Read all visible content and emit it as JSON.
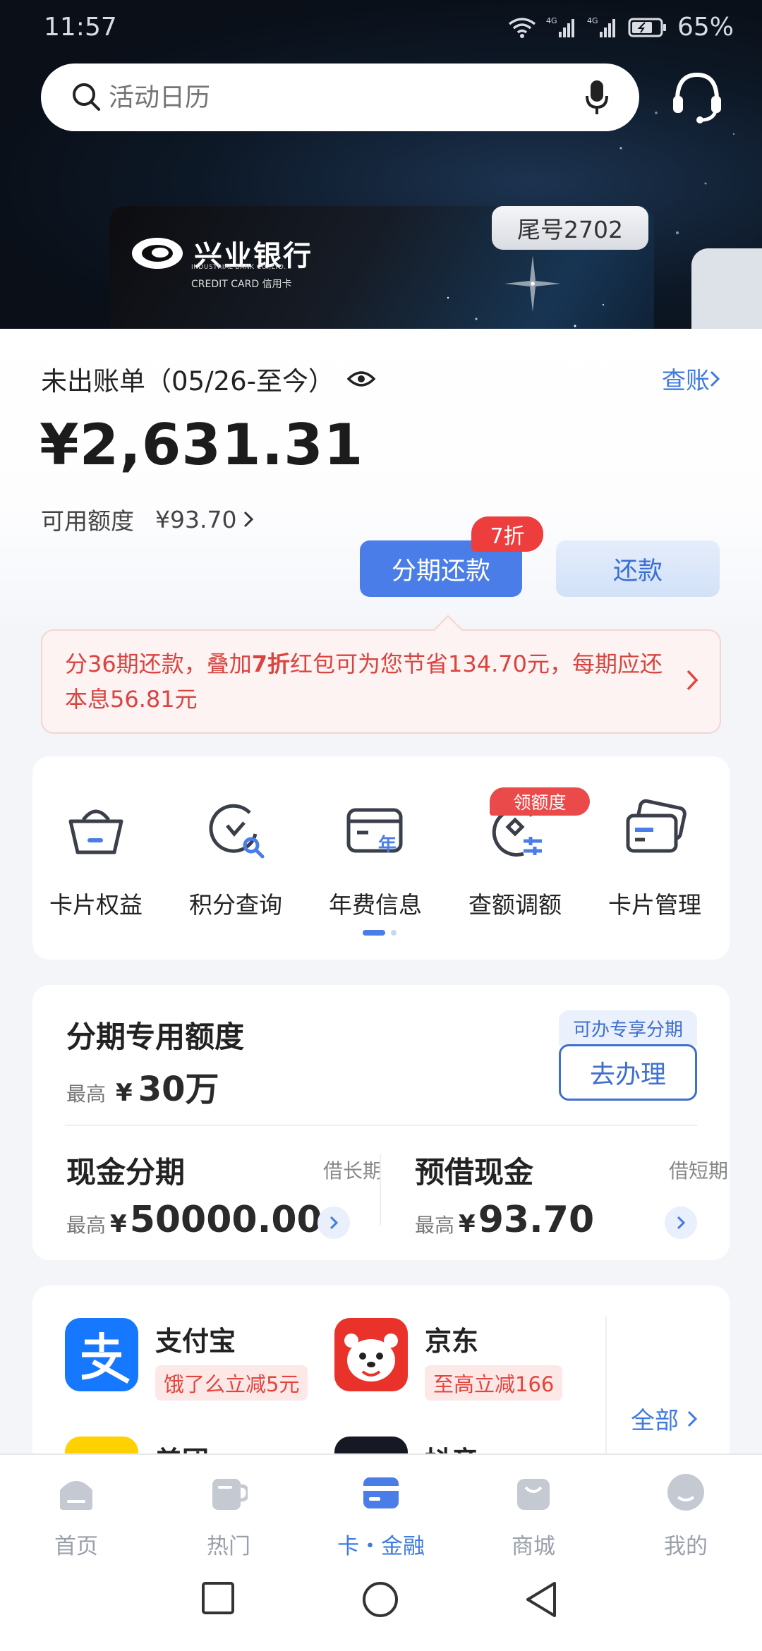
{
  "status_bar": {
    "time": "11:57",
    "battery": "65%",
    "signal_1": "4G",
    "signal_2": "4G"
  },
  "search": {
    "placeholder": "活动日历"
  },
  "card": {
    "bank_name": "兴业银行",
    "bank_english": "INDUSTRIAL BANK CO.,LTD.",
    "card_type": "CREDIT CARD 信用卡",
    "tail_number": "尾号2702"
  },
  "bill": {
    "period": "未出账单（05/26-至今）",
    "check_link": "查账",
    "amount": "¥2,631.31",
    "credit_label": "可用额度",
    "credit_value": "¥93.70",
    "installment_button": "分期还款",
    "discount_badge": "7折",
    "repay_button": "还款"
  },
  "promo": {
    "part1": "分36期还款，叠加",
    "highlight": "7折",
    "part2": "红包可为您节省134.70元，每期应还本息56.81元"
  },
  "services": {
    "items": [
      {
        "label": "卡片权益",
        "icon": "basket-icon"
      },
      {
        "label": "积分查询",
        "icon": "points-search-icon"
      },
      {
        "label": "年费信息",
        "icon": "annual-fee-icon"
      },
      {
        "label": "查额调额",
        "icon": "limit-adjust-icon"
      },
      {
        "label": "卡片管理",
        "icon": "cards-icon"
      }
    ],
    "badge": "领额度"
  },
  "installment_limit": {
    "title": "分期专用额度",
    "max_label": "最高",
    "max_yen": "¥",
    "max_value": "30万",
    "exclusive_tag": "可办专享分期",
    "go_button": "去办理",
    "cash_installment": {
      "title": "现金分期",
      "term": "借长期",
      "max_label": "最高",
      "yen": "¥",
      "value": "50000.00"
    },
    "cash_advance": {
      "title": "预借现金",
      "term": "借短期",
      "max_label": "最高",
      "yen": "¥",
      "value": "93.70"
    }
  },
  "merchants": {
    "items": [
      {
        "name": "支付宝",
        "offer": "饿了么立减5元",
        "color": "#1677ff"
      },
      {
        "name": "京东",
        "offer": "至高立减166",
        "color": "#e9322a"
      }
    ],
    "peek": [
      {
        "name": "美团",
        "color": "#ffd100"
      },
      {
        "name": "抖音",
        "color": "#161823"
      }
    ],
    "all_link": "全部"
  },
  "bottom_nav": {
    "items": [
      {
        "label": "首页",
        "active": false
      },
      {
        "label": "热门",
        "active": false
      },
      {
        "label": "卡・金融",
        "active": true
      },
      {
        "label": "商城",
        "active": false
      },
      {
        "label": "我的",
        "active": false
      }
    ]
  },
  "colors": {
    "accent": "#4a7de8",
    "link": "#3f7ae0",
    "alert_red": "#e2453d"
  }
}
